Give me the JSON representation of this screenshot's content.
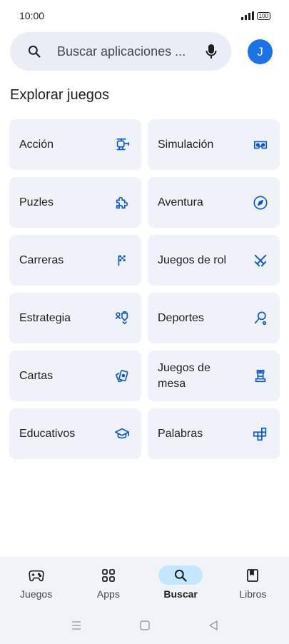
{
  "status": {
    "time": "10:00",
    "battery": "100"
  },
  "search": {
    "placeholder": "Buscar aplicaciones ...",
    "avatar_letter": "J"
  },
  "section_title": "Explorar juegos",
  "categories": [
    {
      "label": "Acción",
      "icon": "helicopter-icon"
    },
    {
      "label": "Simulación",
      "icon": "vr-headset-icon"
    },
    {
      "label": "Puzles",
      "icon": "puzzle-icon"
    },
    {
      "label": "Aventura",
      "icon": "compass-icon"
    },
    {
      "label": "Carreras",
      "icon": "checkered-flag-icon"
    },
    {
      "label": "Juegos de rol",
      "icon": "crossed-swords-icon"
    },
    {
      "label": "Estrategia",
      "icon": "strategy-icon"
    },
    {
      "label": "Deportes",
      "icon": "racket-icon"
    },
    {
      "label": "Cartas",
      "icon": "cards-icon"
    },
    {
      "label": "Juegos de mesa",
      "icon": "chess-rook-icon"
    },
    {
      "label": "Educativos",
      "icon": "graduation-cap-icon"
    },
    {
      "label": "Palabras",
      "icon": "word-tiles-icon"
    }
  ],
  "bottom_nav": [
    {
      "label": "Juegos",
      "icon": "gamepad-icon",
      "active": false
    },
    {
      "label": "Apps",
      "icon": "apps-grid-icon",
      "active": false
    },
    {
      "label": "Buscar",
      "icon": "search-icon",
      "active": true
    },
    {
      "label": "Libros",
      "icon": "book-icon",
      "active": false
    }
  ],
  "colors": {
    "accent": "#1a73e8",
    "icon_blue": "#0b57d0",
    "tile_bg": "#eff2f8",
    "search_bg": "#e9eef6",
    "nav_bg": "#f0f4f9",
    "active_pill": "#c2e7ff"
  }
}
